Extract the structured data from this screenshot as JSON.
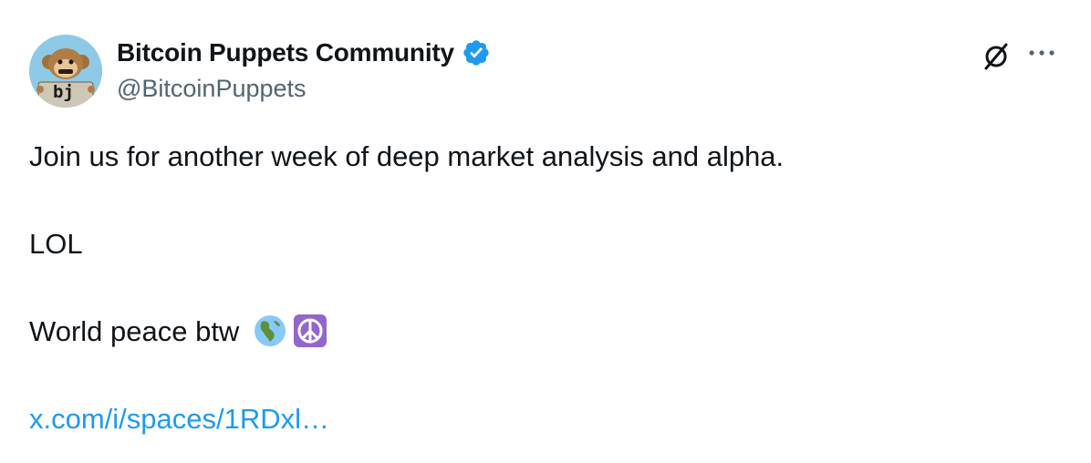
{
  "author": {
    "display_name": "Bitcoin Puppets Community",
    "handle": "@BitcoinPuppets",
    "verified": true,
    "verified_color": "#1d9bf0",
    "avatar_text": "bj"
  },
  "actions": {
    "grok_icon": "grok-icon",
    "more_label": "···"
  },
  "tweet": {
    "line1": "Join us for another week of deep market analysis and alpha.",
    "line2": "LOL",
    "line3": "World peace btw",
    "emojis": [
      "globe-europe-africa",
      "peace-symbol"
    ],
    "link_text": "x.com/i/spaces/1RDxl…"
  },
  "colors": {
    "text": "#0f1419",
    "secondary": "#536471",
    "link": "#1d9bf0"
  }
}
